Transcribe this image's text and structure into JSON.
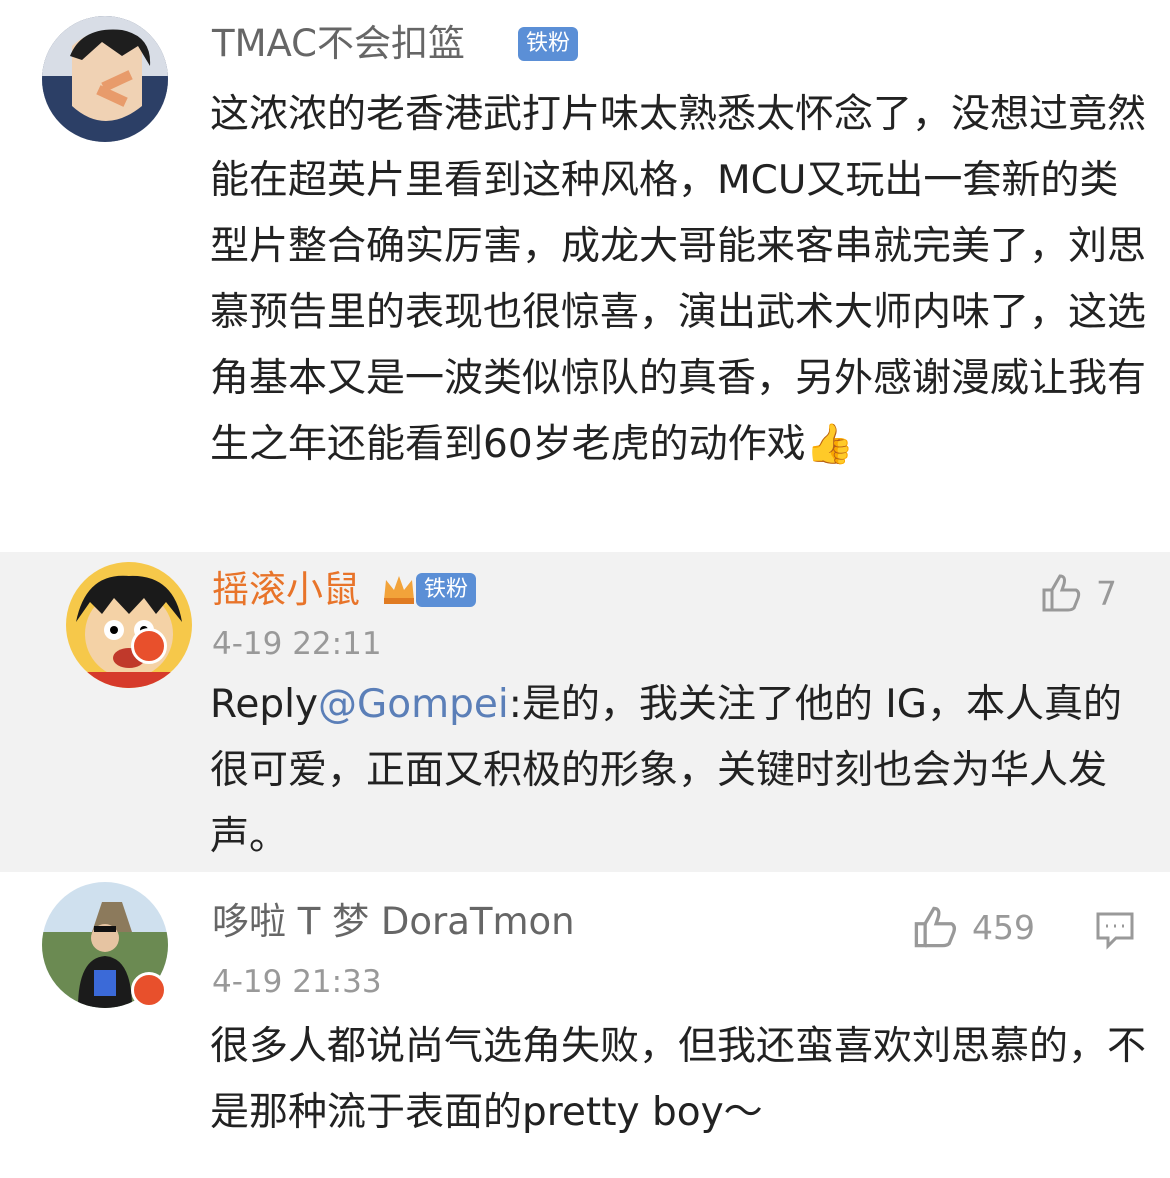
{
  "comments": [
    {
      "username": "TMAC不会扣篮",
      "badge": "铁粉",
      "text": "这浓浓的老香港武打片味太熟悉太怀念了，没想过竟然能在超英片里看到这种风格，MCU又玩出一套新的类型片整合确实厉害，成龙大哥能来客串就完美了，刘思慕预告里的表现也很惊喜，演出武术大师内味了，这选角基本又是一波类似惊队的真香，另外感谢漫威让我有生之年还能看到60岁老虎的动作戏👍"
    },
    {
      "username": "摇滚小鼠",
      "badge": "铁粉",
      "time": "4-19 22:11",
      "likes": "7",
      "reply_prefix": "Reply",
      "mention": "@Gompei",
      "text": ":是的，我关注了他的 IG，本人真的很可爱，正面又积极的形象，关键时刻也会为华人发声。"
    },
    {
      "username": "哆啦 T 梦 DoraTmon",
      "time": "4-19 21:33",
      "likes": "459",
      "text": "很多人都说尚气选角失败，但我还蛮喜欢刘思慕的，不是那种流于表面的pretty boy～"
    }
  ],
  "colors": {
    "accent_username": "#e8742a",
    "mention": "#5b7fb8",
    "badge_bg": "#5b8fd6",
    "reply_bg": "#f2f2f2",
    "meta_gray": "#999999"
  }
}
